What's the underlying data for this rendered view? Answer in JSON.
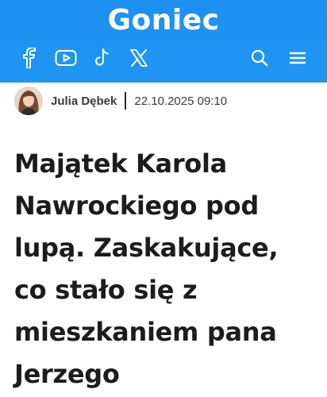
{
  "header": {
    "logo": "Goniec",
    "social_icons": [
      "facebook-icon",
      "youtube-icon",
      "tiktok-icon",
      "x-icon"
    ],
    "actions": [
      "search-icon",
      "menu-icon"
    ],
    "bg_color": "#2196f3"
  },
  "article": {
    "author": "Julia Dębek",
    "date": "22.10.2025 09:10",
    "title": "Majątek Karola Nawrockiego pod lupą. Zaskakujące, co stało się z mieszkaniem pana Jerzego"
  }
}
